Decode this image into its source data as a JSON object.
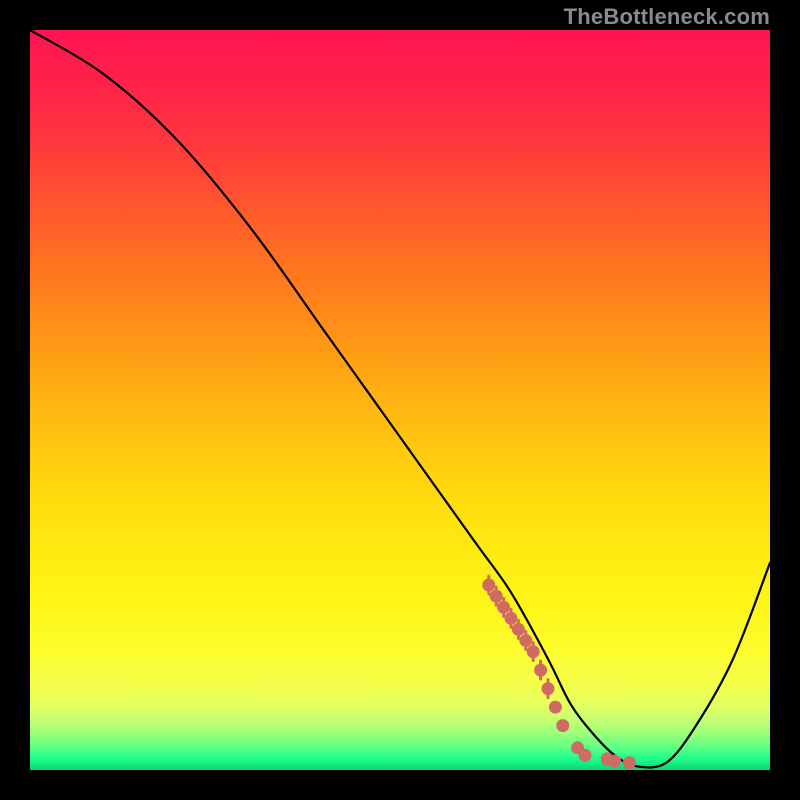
{
  "watermark": "TheBottleneck.com",
  "colors": {
    "frame": "#000000",
    "curve": "#000000",
    "marker": "#cf6b63",
    "watermark": "#8a8a8a"
  },
  "chart_data": {
    "type": "line",
    "title": "",
    "xlabel": "",
    "ylabel": "",
    "xlim": [
      0,
      100
    ],
    "ylim": [
      0,
      100
    ],
    "grid": false,
    "legend": false,
    "series": [
      {
        "name": "bottleneck-curve",
        "x": [
          0,
          10,
          20,
          30,
          40,
          50,
          60,
          65,
          70,
          73,
          76,
          79,
          82,
          86,
          90,
          95,
          100
        ],
        "y": [
          100,
          94,
          85,
          73,
          59,
          45,
          31,
          24,
          15,
          9,
          5,
          2,
          0.5,
          1,
          6,
          15,
          28
        ]
      }
    ],
    "markers": {
      "name": "highlight-points",
      "x": [
        62,
        63,
        64,
        65,
        66,
        67,
        68,
        69,
        70,
        71,
        72,
        74,
        75,
        78,
        79,
        81
      ],
      "y": [
        25,
        23.5,
        22,
        20.5,
        19,
        17.5,
        16,
        13.5,
        11,
        8.5,
        6,
        3,
        2,
        1.5,
        1.2,
        1
      ]
    }
  }
}
